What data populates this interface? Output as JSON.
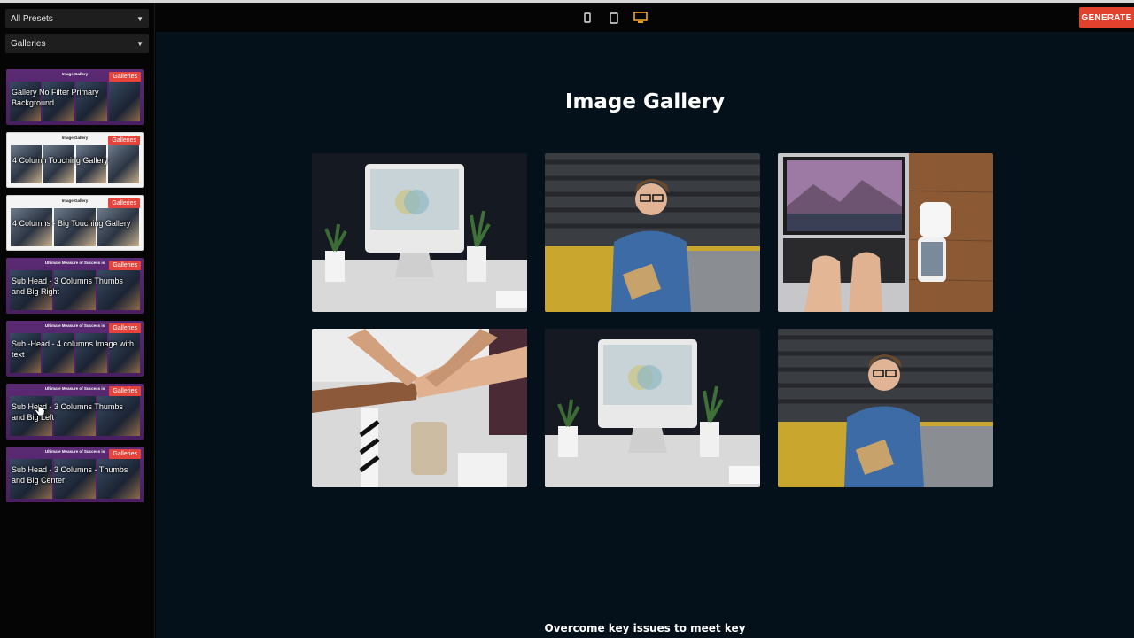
{
  "toolbar": {
    "devices": [
      "mobile-icon",
      "tablet-icon",
      "desktop-icon"
    ],
    "active_device": "desktop-icon",
    "active_color": "#f0a322",
    "generate_label": "GENERATE",
    "generate_color": "#e2412d"
  },
  "sidebar": {
    "filter_select": "All Presets",
    "category_select": "Galleries",
    "presets": [
      {
        "title": "Image Gallery",
        "label": "Gallery No Filter Primary Background",
        "badge": "Galleries"
      },
      {
        "title": "Image Gallery",
        "label": "4 Column Touching Gallery",
        "badge": "Galleries"
      },
      {
        "title": "Image Gallery",
        "label": "4 Columns - Big Touching Gallery",
        "badge": "Galleries"
      },
      {
        "title": "Ultimate Measure of Success is",
        "label": "Sub Head - 3 Columns Thumbs and Big Right",
        "badge": "Galleries"
      },
      {
        "title": "Ultimate Measure of Success is",
        "label": "Sub -Head - 4 columns Image with text",
        "badge": "Galleries"
      },
      {
        "title": "Ultimate Measure of Success is",
        "label": "Sub Head - 3 Columns Thumbs and Big Left",
        "badge": "Galleries"
      },
      {
        "title": "Ultimate Measure of Success is",
        "label": "Sub Head - 3 Columns - Thumbs and Big Center",
        "badge": "Galleries"
      }
    ]
  },
  "main": {
    "title": "Image Gallery",
    "images": [
      "imac-desk",
      "man-writing",
      "laptop-typing",
      "fist-bump",
      "imac-desk",
      "man-writing"
    ],
    "footer": "Overcome key issues to meet key"
  }
}
